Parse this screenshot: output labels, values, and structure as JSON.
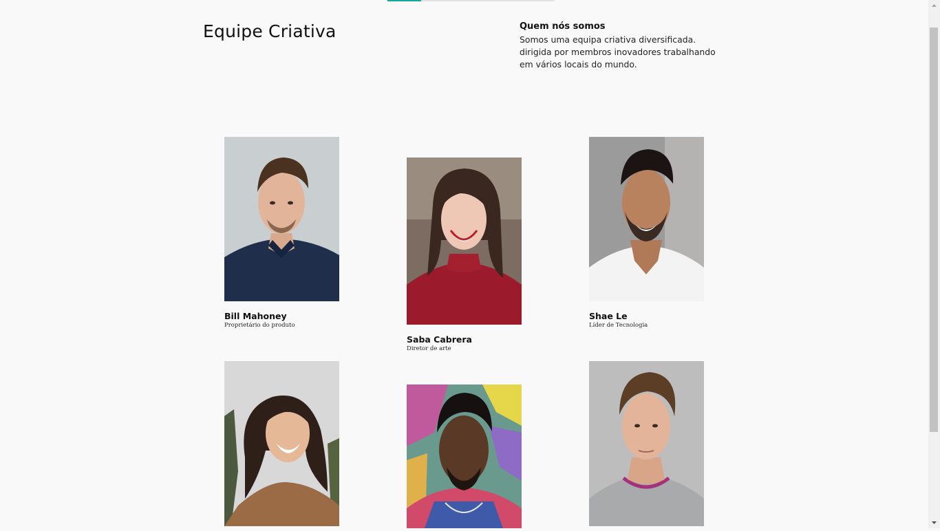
{
  "scroll_progress_fraction": 0.2,
  "colors": {
    "accent": "#14a8a3",
    "background": "#f9f9f9"
  },
  "header": {
    "title": "Equipe Criativa",
    "about_heading": "Quem nós somos",
    "about_text": "Somos uma equipa criativa diversificada. dirigida por membros inovadores trabalhando em vários locais do mundo."
  },
  "team": [
    {
      "name": "Bill Mahoney",
      "role": "Proprietário do produto",
      "photo": "portrait-man-navy-polo"
    },
    {
      "name": "Saba Cabrera",
      "role": "Diretor de arte",
      "photo": "portrait-woman-red-sweater"
    },
    {
      "name": "Shae Le",
      "role": "Líder de Tecnologia",
      "photo": "portrait-man-white-tshirt"
    },
    {
      "name": "",
      "role": "",
      "photo": "portrait-woman-leopard-top"
    },
    {
      "name": "",
      "role": "",
      "photo": "portrait-man-graffiti-wall"
    },
    {
      "name": "",
      "role": "",
      "photo": "portrait-man-grey-sweater"
    }
  ]
}
